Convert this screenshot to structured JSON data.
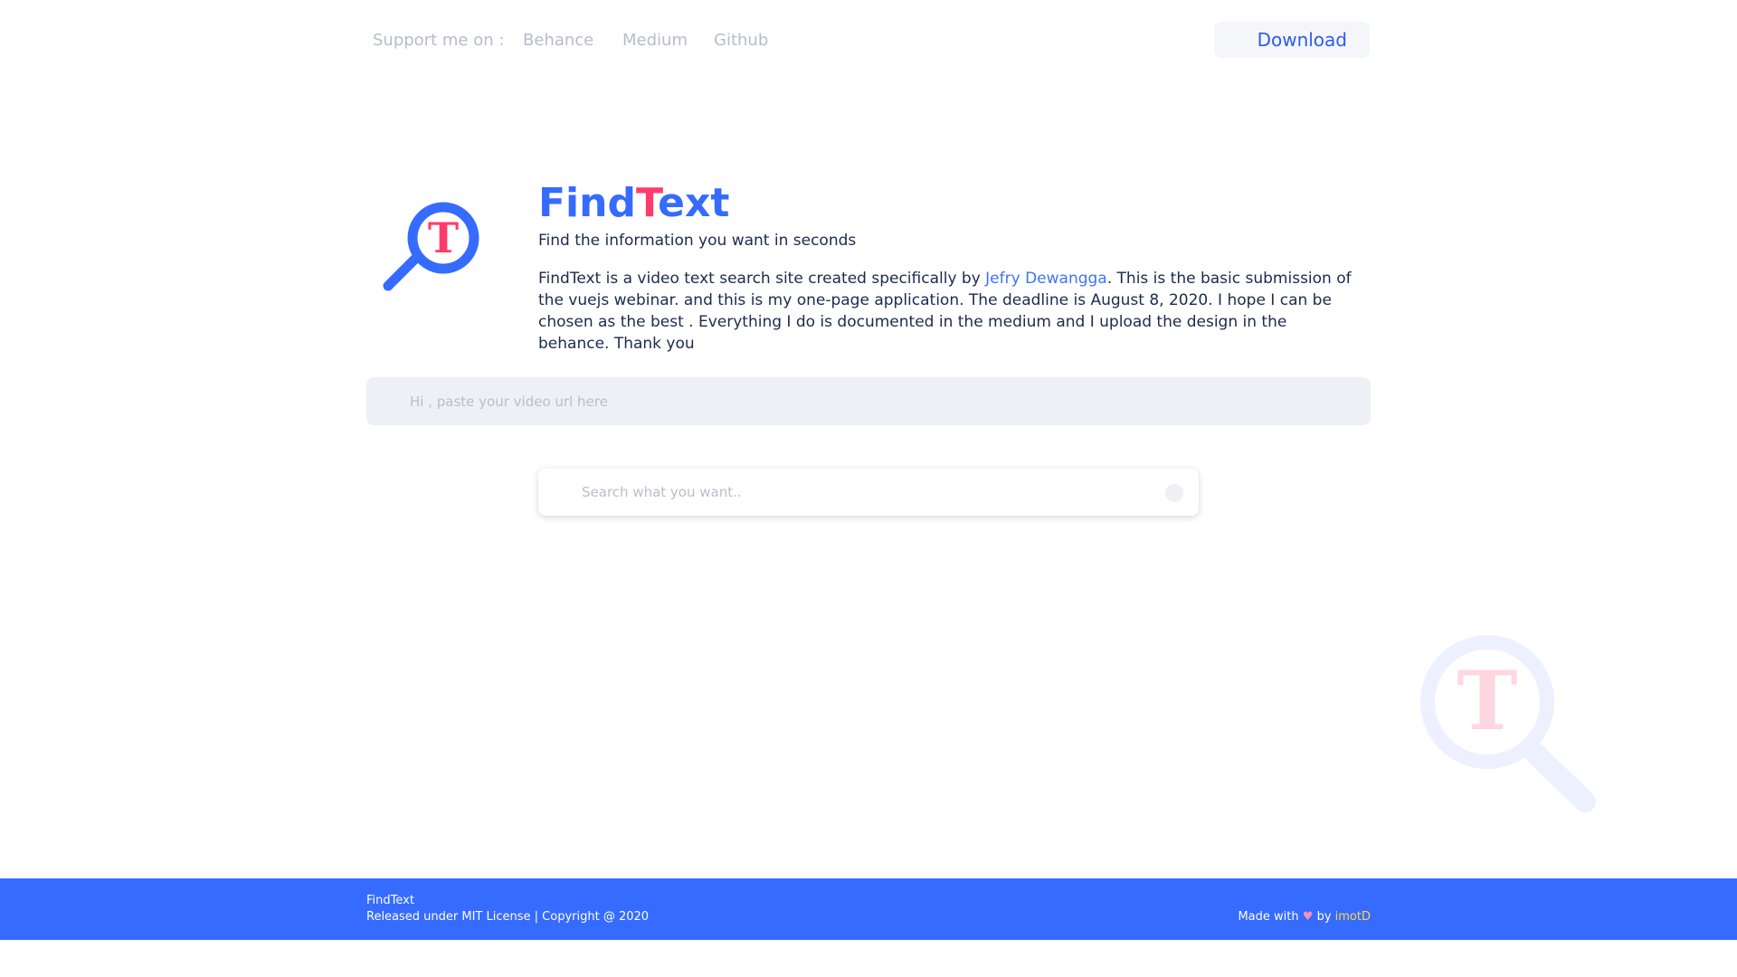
{
  "nav": {
    "support_label": "Support me on :",
    "links": [
      "Behance",
      "Medium",
      "Github"
    ],
    "download_label": "Download"
  },
  "hero": {
    "brand_start": "Find",
    "brand_mid": "T",
    "brand_end": "ext",
    "logo_letter": "T",
    "tagline": "Find the information you want in seconds",
    "desc_before": "FindText is a video text search site created specifically by ",
    "desc_author": "Jefry Dewangga",
    "desc_after": ". This is the basic submission of the vuejs webinar. and this is my one-page application. The deadline is August 8, 2020. I hope I can be chosen as the best . Everything I do is documented in the medium and I upload the design in the behance. Thank you"
  },
  "url_input": {
    "placeholder": "Hi , paste your video url here"
  },
  "search": {
    "placeholder": "Search what you want.."
  },
  "footer": {
    "name": "FindText",
    "license": "Released under MIT License | Copyright @ 2020",
    "made_with": "Made with",
    "heart": "♥",
    "by": "by",
    "author": "imotD"
  },
  "colors": {
    "brand_blue": "#356bff",
    "brand_pink": "#ff3b6b",
    "footer_bg": "#356bff",
    "author_link": "#3d75f4",
    "footer_author": "#ffd84a"
  },
  "icons": {
    "logo": "magnifier-t-icon",
    "decoration": "magnifier-t-icon",
    "search_button": "search-icon"
  }
}
